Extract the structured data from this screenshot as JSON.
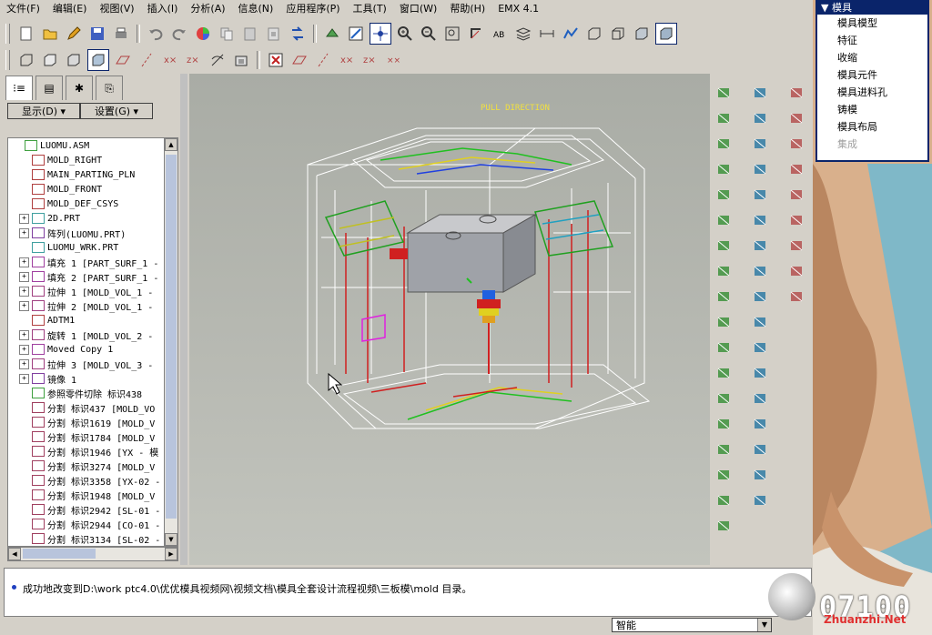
{
  "menubar": {
    "items": [
      "文件(F)",
      "编辑(E)",
      "视图(V)",
      "插入(I)",
      "分析(A)",
      "信息(N)",
      "应用程序(P)",
      "工具(T)",
      "窗口(W)",
      "帮助(H)",
      "EMX 4.1"
    ]
  },
  "left_panel": {
    "display_dropdown": "显示(D) ▾",
    "settings_dropdown": "设置(G) ▾",
    "tree": [
      {
        "label": "LUOMU.ASM",
        "icon": "assembly-icon",
        "expander": false,
        "root": true
      },
      {
        "label": "MOLD_RIGHT",
        "icon": "datum-plane-icon",
        "expander": false
      },
      {
        "label": "MAIN_PARTING_PLN",
        "icon": "datum-plane-icon",
        "expander": false
      },
      {
        "label": "MOLD_FRONT",
        "icon": "datum-plane-icon",
        "expander": false
      },
      {
        "label": "MOLD_DEF_CSYS",
        "icon": "csys-icon",
        "expander": false
      },
      {
        "label": "2D.PRT",
        "icon": "part-icon",
        "expander": true
      },
      {
        "label": "阵列(LUOMU.PRT)",
        "icon": "pattern-icon",
        "expander": true
      },
      {
        "label": "LUOMU_WRK.PRT",
        "icon": "part-icon",
        "expander": false
      },
      {
        "label": "填充 1 [PART_SURF_1 -",
        "icon": "fill-icon",
        "expander": true
      },
      {
        "label": "填充 2 [PART_SURF_1 -",
        "icon": "fill-icon",
        "expander": true
      },
      {
        "label": "拉伸 1 [MOLD_VOL_1 - ",
        "icon": "extrude-icon",
        "expander": true
      },
      {
        "label": "拉伸 2 [MOLD_VOL_1 - ",
        "icon": "extrude-icon",
        "expander": true
      },
      {
        "label": "ADTM1",
        "icon": "datum-plane-icon",
        "expander": false
      },
      {
        "label": "旋转 1 [MOLD_VOL_2 - ",
        "icon": "revolve-icon",
        "expander": true
      },
      {
        "label": "Moved Copy 1",
        "icon": "move-copy-icon",
        "expander": true
      },
      {
        "label": "拉伸 3 [MOLD_VOL_3 - ",
        "icon": "extrude-icon",
        "expander": true
      },
      {
        "label": "镜像 1",
        "icon": "mirror-icon",
        "expander": true
      },
      {
        "label": "参照零件切除 标识438",
        "icon": "ref-cut-icon",
        "expander": false
      },
      {
        "label": "分割 标识437 [MOLD_VO",
        "icon": "split-icon",
        "expander": false
      },
      {
        "label": "分割 标识1619 [MOLD_V",
        "icon": "split-icon",
        "expander": false
      },
      {
        "label": "分割 标识1784 [MOLD_V",
        "icon": "split-icon",
        "expander": false
      },
      {
        "label": "分割 标识1946 [YX - 模",
        "icon": "split-icon",
        "expander": false
      },
      {
        "label": "分割 标识3274 [MOLD_V",
        "icon": "split-icon",
        "expander": false
      },
      {
        "label": "分割 标识3358 [YX-02 -",
        "icon": "split-icon",
        "expander": false
      },
      {
        "label": "分割 标识1948 [MOLD_V",
        "icon": "split-icon",
        "expander": false
      },
      {
        "label": "分割 标识2942 [SL-01 -",
        "icon": "split-icon",
        "expander": false
      },
      {
        "label": "分割 标识2944 [CO-01 -",
        "icon": "split-icon",
        "expander": false
      },
      {
        "label": "分割 标识3134 [SL-02 -",
        "icon": "split-icon",
        "expander": false
      }
    ]
  },
  "graphics": {
    "annotation": "PULL DIRECTION"
  },
  "status": {
    "message": "成功地改变到D:\\work ptc4.0\\优优模具视频网\\视频文档\\模具全套设计流程视频\\三板模\\mold 目录。"
  },
  "bottom": {
    "filter_value": "智能"
  },
  "mold_menu": {
    "title": "▼ 模具",
    "items": [
      {
        "label": "模具模型",
        "enabled": true
      },
      {
        "label": "特征",
        "enabled": true
      },
      {
        "label": "收缩",
        "enabled": true
      },
      {
        "label": "模具元件",
        "enabled": true
      },
      {
        "label": "模具进料孔",
        "enabled": true
      },
      {
        "label": "铸模",
        "enabled": true
      },
      {
        "label": "模具布局",
        "enabled": true
      },
      {
        "label": "集成",
        "enabled": false
      }
    ]
  },
  "overlay": {
    "counter": "07100",
    "watermark": "Zhuanzhi.Net"
  }
}
